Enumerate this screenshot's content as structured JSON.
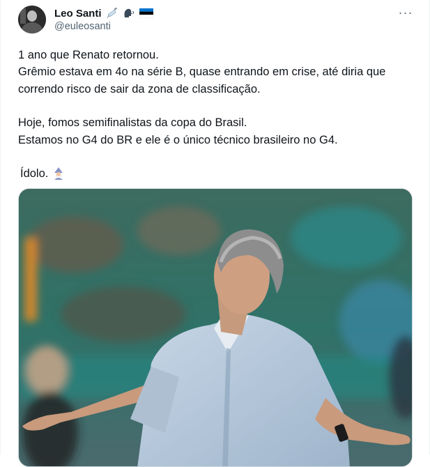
{
  "author": {
    "display_name": "Leo Santi",
    "handle": "@euleosanti",
    "name_emojis": [
      "syringe-icon",
      "speaking-head-icon",
      "estonia-flag-icon"
    ]
  },
  "menu": {
    "more_label": "···"
  },
  "tweet": {
    "lines": [
      "1 ano que Renato retornou.",
      "Grêmio estava em 4o na série B, quase entrando em crise, até diria que",
      "correndo risco de sair da zona de classificação.",
      "",
      "Hoje, fomos semifinalistas da copa do Brasil.",
      "Estamos no G4 do BR e ele é o único técnico brasileiro no G4.",
      "",
      "Ídolo."
    ],
    "trailing_emoji": "man-mage-icon"
  },
  "media": {
    "type": "photo",
    "subject": "coach-gesturing-photo"
  },
  "colors": {
    "text_primary": "#0f1419",
    "text_secondary": "#536471",
    "border": "#cfd9de"
  }
}
